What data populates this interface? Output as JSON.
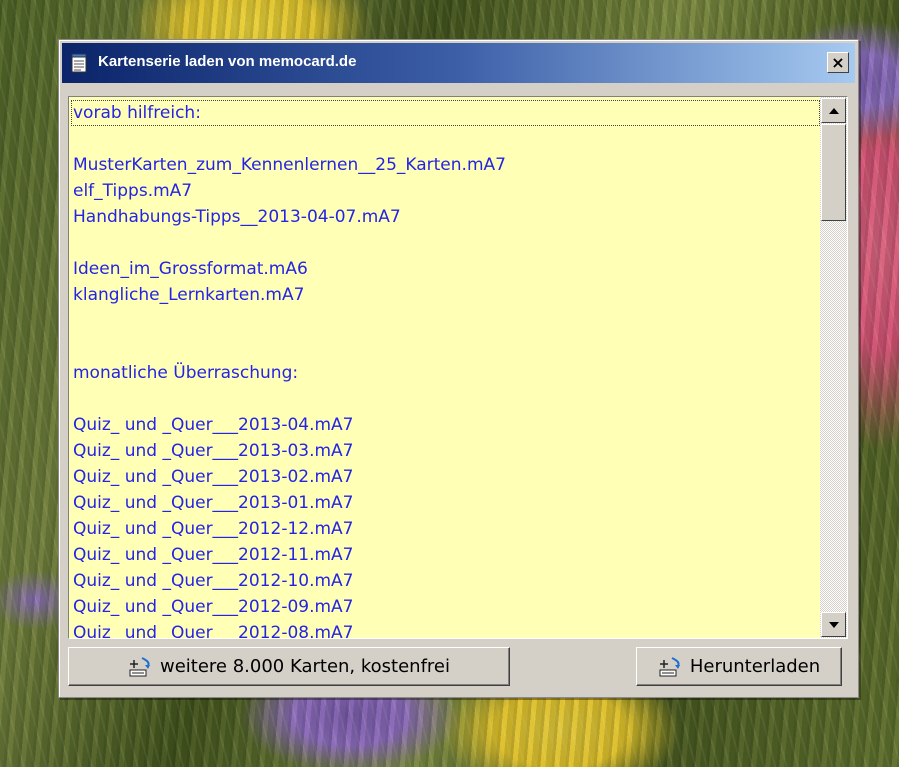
{
  "window": {
    "title": "Kartenserie laden von memocard.de",
    "close_label": "×"
  },
  "list": {
    "items": [
      "vorab hilfreich:",
      "",
      "MusterKarten_zum_Kennenlernen__25_Karten.mA7",
      "elf_Tipps.mA7",
      "Handhabungs-Tipps__2013-04-07.mA7",
      "",
      "Ideen_im_Grossformat.mA6",
      "klangliche_Lernkarten.mA7",
      "",
      "",
      "monatliche Überraschung:",
      "",
      "Quiz_ und _Quer___2013-04.mA7",
      "Quiz_ und _Quer___2013-03.mA7",
      "Quiz_ und _Quer___2013-02.mA7",
      "Quiz_ und _Quer___2013-01.mA7",
      "Quiz_ und _Quer___2012-12.mA7",
      "Quiz_ und _Quer___2012-11.mA7",
      "Quiz_ und _Quer___2012-10.mA7",
      "Quiz_ und _Quer___2012-09.mA7",
      "Quiz_ und _Quer___2012-08.mA7"
    ],
    "text_color": "#2424e6",
    "background": "#ffffb5"
  },
  "buttons": {
    "more_label": "weitere 8.000 Karten, kostenfrei",
    "download_label": "Herunterladen"
  },
  "icons": {
    "title": "notepad-icon",
    "scroll_up": "arrow-up-icon",
    "scroll_down": "arrow-down-icon",
    "button": "download-icon"
  }
}
